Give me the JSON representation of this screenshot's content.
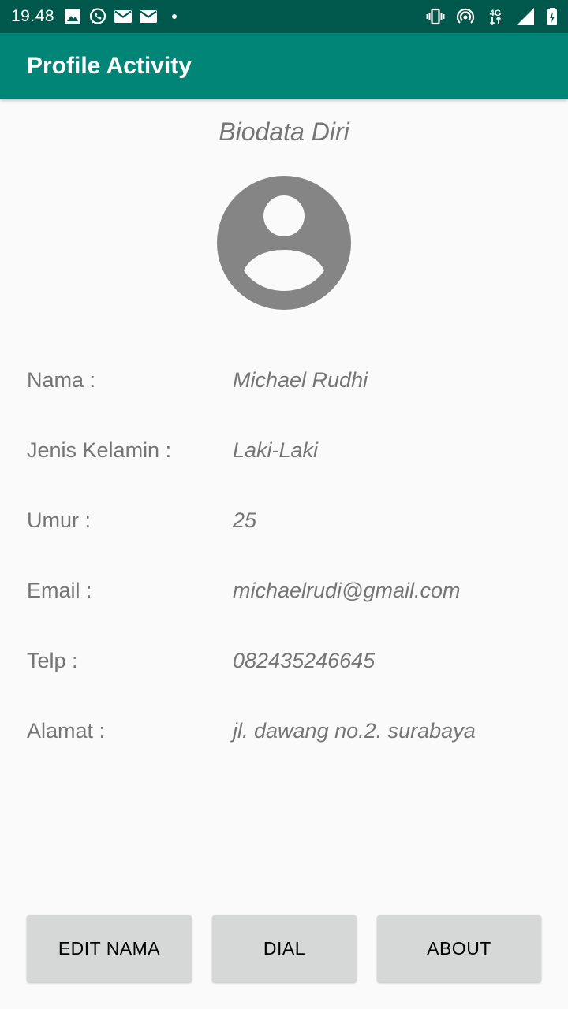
{
  "status_bar": {
    "time": "19.48",
    "network_label": "4G",
    "left_icons": [
      "image-icon",
      "whatsapp-icon",
      "gmail-icon",
      "gmail-icon",
      "more-dot-icon"
    ],
    "right_icons": [
      "vibrate-icon",
      "hotspot-icon",
      "4g-data-icon",
      "signal-icon",
      "battery-icon"
    ]
  },
  "app_bar": {
    "title": "Profile Activity"
  },
  "profile": {
    "section_title": "Biodata Diri",
    "avatar_icon": "account-circle-icon",
    "fields": [
      {
        "label": "Nama :",
        "value": "Michael Rudhi"
      },
      {
        "label": "Jenis Kelamin :",
        "value": "Laki-Laki"
      },
      {
        "label": "Umur :",
        "value": "25"
      },
      {
        "label": "Email :",
        "value": "michaelrudi@gmail.com"
      },
      {
        "label": "Telp :",
        "value": "082435246645"
      },
      {
        "label": "Alamat :",
        "value": "jl. dawang no.2. surabaya"
      }
    ]
  },
  "buttons": {
    "edit_nama": "EDIT NAMA",
    "dial": "DIAL",
    "about": "ABOUT"
  },
  "colors": {
    "status_bar": "#00574b",
    "app_bar": "#008577",
    "background": "#fafafa",
    "text_gray": "#757575",
    "button_bg": "#d6d7d7",
    "avatar_gray": "#858585"
  }
}
